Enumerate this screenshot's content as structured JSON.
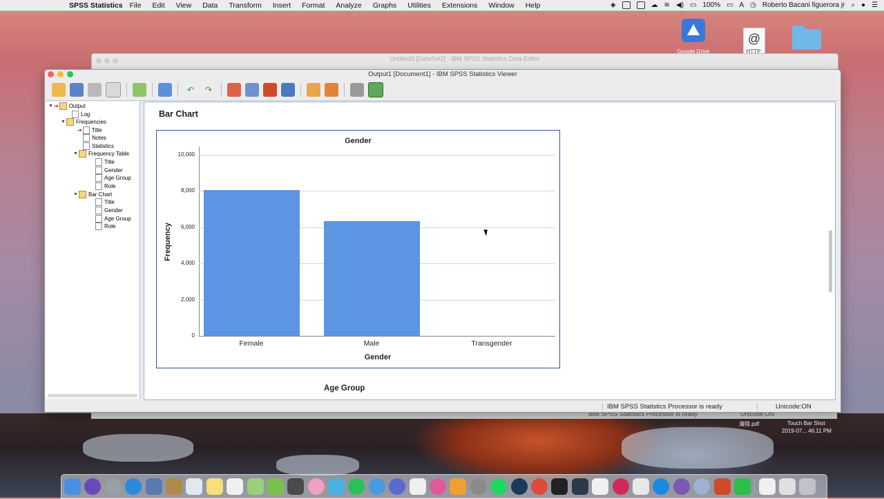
{
  "menubar": {
    "app_name": "SPSS Statistics",
    "items": [
      "File",
      "Edit",
      "View",
      "Data",
      "Transform",
      "Insert",
      "Format",
      "Analyze",
      "Graphs",
      "Utilities",
      "Extensions",
      "Window",
      "Help"
    ],
    "battery": "100%",
    "input_source": "A",
    "user": "Roberto Bacani figuerora jr"
  },
  "desktop": {
    "icons": [
      {
        "label": "Google Drive",
        "icon": "google-drive-icon"
      },
      {
        "label": "HTTP",
        "icon": "http-file-icon"
      },
      {
        "label": "",
        "icon": "folder-icon"
      }
    ],
    "file_label": "清除.pdf",
    "screenshot_label": "Touch Bar Shot",
    "screenshot_date": "2019-07... 46.11 PM"
  },
  "back_window": {
    "title": "Untitled3 [DataSet2] - IBM SPSS Statistics Data Editor",
    "status": "IBM SPSS Statistics Processor is ready",
    "unicode": "Unicode:ON"
  },
  "viewer": {
    "title": "Output1 [Document1] - IBM SPSS Statistics Viewer",
    "toolbar_icons": [
      "open-icon",
      "save-icon",
      "print-icon",
      "print-preview-icon",
      "export-icon",
      "goto-data-icon",
      "undo-icon",
      "redo-icon",
      "goto-case-icon",
      "goto-variable-icon",
      "insert-output-icon",
      "variables-icon",
      "designate-window-icon",
      "show-all-icon",
      "hide-icon",
      "promote-icon",
      "demote-icon"
    ],
    "tree": {
      "output": "Output",
      "log": "Log",
      "frequencies": "Frequencies",
      "freq_title": "Title",
      "notes": "Notes",
      "statistics": "Statistics",
      "frequency_table": "Frequency Table",
      "ft_title": "Title",
      "ft_gender": "Gender",
      "ft_age_group": "Age Group",
      "ft_role": "Role",
      "bar_chart": "Bar Chart",
      "bc_title": "Title",
      "bc_gender": "Gender",
      "bc_age_group": "Age Group",
      "bc_role": "Role"
    },
    "section_heading": "Bar Chart",
    "next_chart_title": "Age Group",
    "status_text": "IBM SPSS Statistics Processor is ready",
    "unicode_status": "Unicode:ON"
  },
  "chart_data": {
    "type": "bar",
    "title": "Gender",
    "xlabel": "Gender",
    "ylabel": "Frequency",
    "categories": [
      "Female",
      "Male",
      "Transgender"
    ],
    "values": [
      8050,
      6350,
      0
    ],
    "ylim": [
      0,
      10000
    ],
    "yticks": [
      "0",
      "2,000",
      "4,000",
      "6,000",
      "8,000",
      "10,000"
    ],
    "ytick_values": [
      0,
      2000,
      4000,
      6000,
      8000,
      10000
    ],
    "bar_color": "#5b95e3",
    "grid": true,
    "legend": "none"
  }
}
